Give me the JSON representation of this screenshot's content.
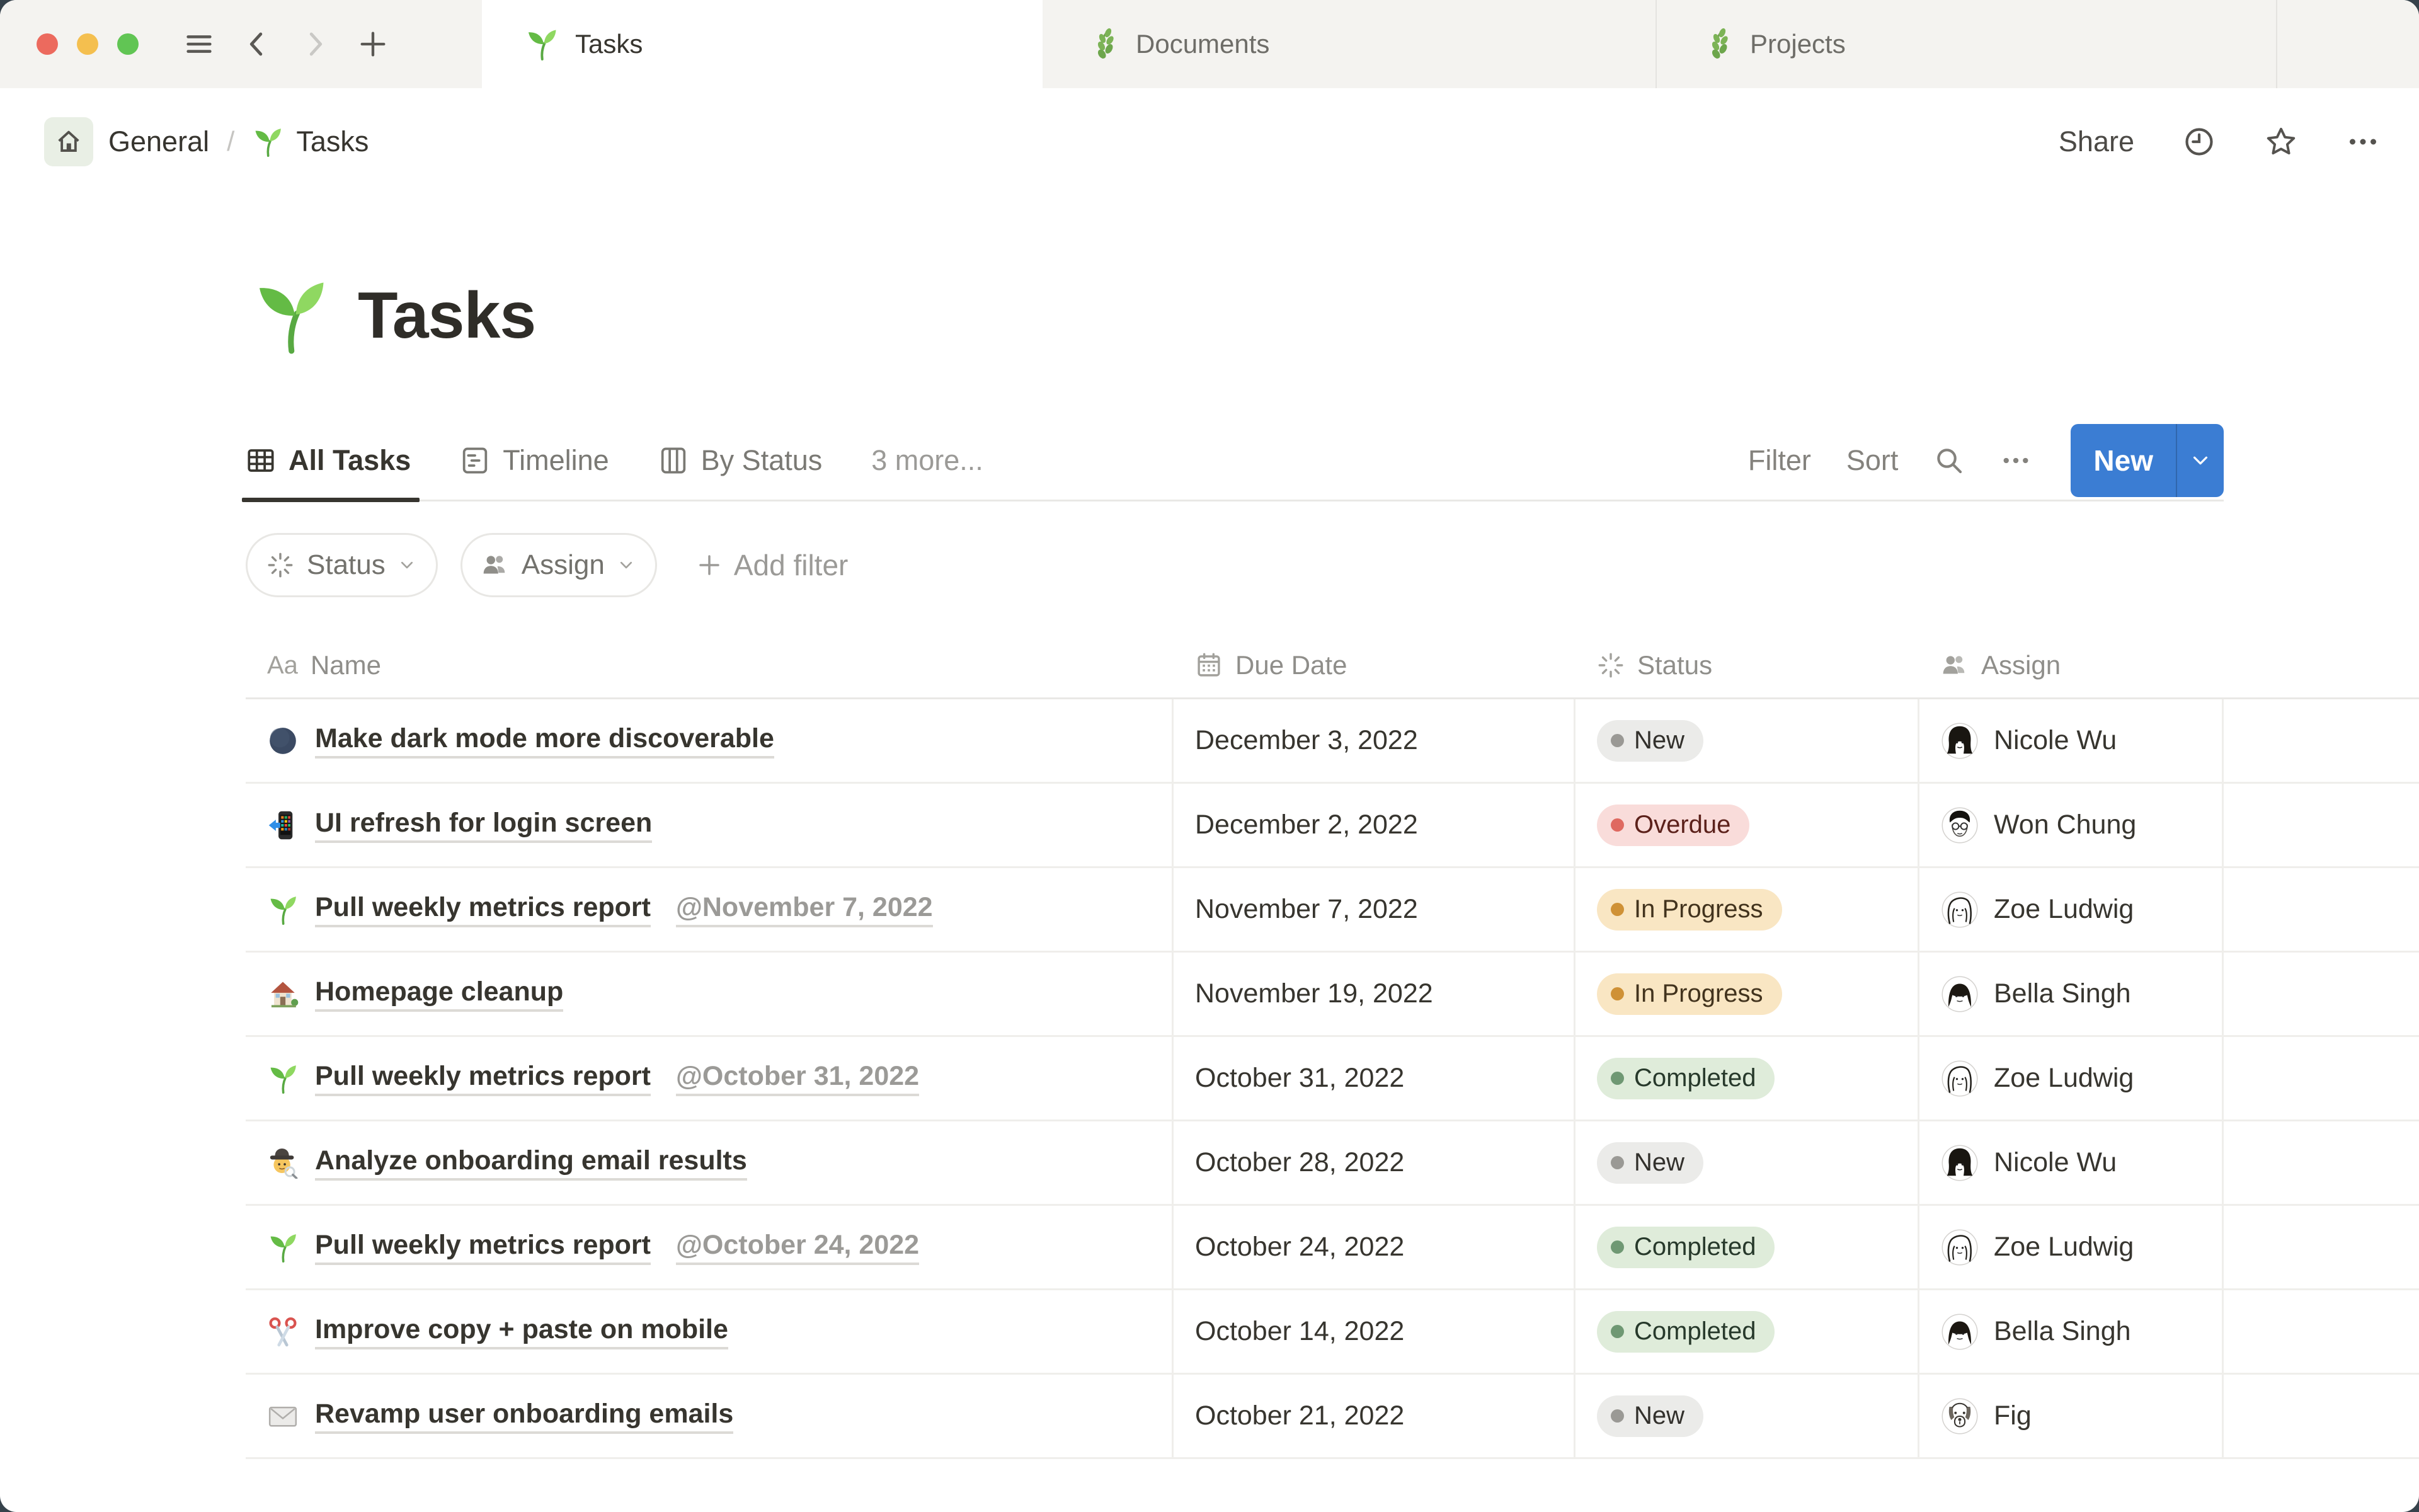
{
  "colors": {
    "accent_blue": "#3b7dd3",
    "traffic_lights": [
      "#ec6a5e",
      "#f4bf4f",
      "#61c554"
    ],
    "status_palette": {
      "new": {
        "bg": "#ebebe9",
        "dot": "#9a9995",
        "text": "#32302c"
      },
      "overdue": {
        "bg": "#f9dcda",
        "dot": "#df6960",
        "text": "#5c211b"
      },
      "in_progress": {
        "bg": "#f9e6c3",
        "dot": "#cf9136",
        "text": "#42331d"
      },
      "completed": {
        "bg": "#dfecda",
        "dot": "#6f9873",
        "text": "#27392b"
      }
    }
  },
  "window_tabs": {
    "active_label": "Tasks",
    "documents_label": "Documents",
    "projects_label": "Projects"
  },
  "breadcrumb": {
    "workspace": "General",
    "separator": "/",
    "page": "Tasks"
  },
  "top_actions": {
    "share_label": "Share"
  },
  "page": {
    "title": "Tasks"
  },
  "view_tabs": {
    "all_tasks": "All Tasks",
    "timeline": "Timeline",
    "by_status": "By Status",
    "more_label": "3 more...",
    "active": "All Tasks"
  },
  "toolbar": {
    "filter_label": "Filter",
    "sort_label": "Sort",
    "new_label": "New"
  },
  "filter_bar": {
    "chips": [
      {
        "label": "Status"
      },
      {
        "label": "Assign"
      }
    ],
    "add_filter_label": "Add filter"
  },
  "table": {
    "columns": {
      "name": "Name",
      "due": "Due Date",
      "status": "Status",
      "assign": "Assign"
    },
    "name_type_glyph": "Aa",
    "rows": [
      {
        "icon": "new-moon",
        "name": "Make dark mode more discoverable",
        "due": "December 3, 2022",
        "status": "New",
        "status_key": "new",
        "assignee": "Nicole Wu"
      },
      {
        "icon": "phone-arrow",
        "name": "UI refresh for login screen",
        "due": "December 2, 2022",
        "status": "Overdue",
        "status_key": "overdue",
        "assignee": "Won Chung"
      },
      {
        "icon": "seedling",
        "name": "Pull weekly metrics report",
        "mention": "@November 7, 2022",
        "due": "November 7, 2022",
        "status": "In Progress",
        "status_key": "in_progress",
        "assignee": "Zoe Ludwig"
      },
      {
        "icon": "house-garden",
        "name": "Homepage cleanup",
        "due": "November 19, 2022",
        "status": "In Progress",
        "status_key": "in_progress",
        "assignee": "Bella Singh"
      },
      {
        "icon": "seedling",
        "name": "Pull weekly metrics report",
        "mention": "@October 31, 2022",
        "due": "October 31, 2022",
        "status": "Completed",
        "status_key": "completed",
        "assignee": "Zoe Ludwig"
      },
      {
        "icon": "detective",
        "name": "Analyze onboarding email results",
        "due": "October 28, 2022",
        "status": "New",
        "status_key": "new",
        "assignee": "Nicole Wu"
      },
      {
        "icon": "seedling",
        "name": "Pull weekly metrics report",
        "mention": "@October 24, 2022",
        "due": "October 24, 2022",
        "status": "Completed",
        "status_key": "completed",
        "assignee": "Zoe Ludwig"
      },
      {
        "icon": "scissors",
        "name": "Improve copy + paste on mobile",
        "due": "October 14, 2022",
        "status": "Completed",
        "status_key": "completed",
        "assignee": "Bella Singh"
      },
      {
        "icon": "envelope",
        "name": "Revamp user onboarding emails",
        "due": "October 21, 2022",
        "status": "New",
        "status_key": "new",
        "assignee": "Fig"
      }
    ]
  }
}
